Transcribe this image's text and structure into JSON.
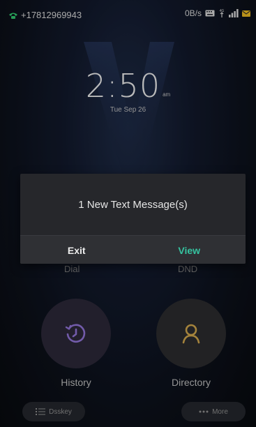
{
  "status_bar": {
    "line_number": "+17812969943",
    "net_speed": "0B/s",
    "icons": [
      "phone-icon",
      "keyboard-icon",
      "4g-icon",
      "signal-icon",
      "mail-icon"
    ]
  },
  "clock": {
    "time": "2:50",
    "ampm": "am",
    "date": "Tue Sep 26"
  },
  "background_labels": {
    "dial": "Dial",
    "dnd": "DND"
  },
  "dialog": {
    "message": "1 New Text Message(s)",
    "exit_label": "Exit",
    "view_label": "View"
  },
  "shortcuts": [
    {
      "label": "History",
      "icon": "history-icon"
    },
    {
      "label": "Directory",
      "icon": "contact-icon"
    }
  ],
  "soft_keys": {
    "dsskey_label": "Dsskey",
    "more_label": "More"
  },
  "colors": {
    "accent": "#35c3a0",
    "history_icon": "#8c6fd0",
    "directory_icon": "#c9a04a",
    "phone_icon": "#2fbf6a",
    "mail_icon": "#e0b020"
  }
}
